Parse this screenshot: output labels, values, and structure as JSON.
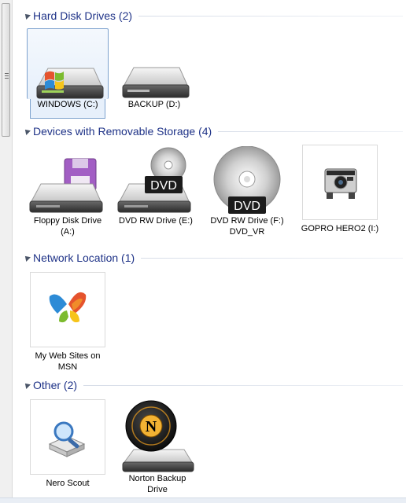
{
  "groups": {
    "hdd": {
      "title": "Hard Disk Drives (2)",
      "items": [
        {
          "label": "WINDOWS (C:)",
          "icon": "windows-drive-icon"
        },
        {
          "label": "BACKUP (D:)",
          "icon": "hard-drive-icon"
        }
      ]
    },
    "removable": {
      "title": "Devices with Removable Storage (4)",
      "items": [
        {
          "label": "Floppy Disk Drive (A:)",
          "icon": "floppy-drive-icon"
        },
        {
          "label": "DVD RW Drive (E:)",
          "icon": "dvd-drive-icon",
          "badge": "DVD"
        },
        {
          "label": "DVD RW Drive (F:) DVD_VR",
          "icon": "dvd-disc-icon",
          "badge": "DVD"
        },
        {
          "label": "GOPRO HERO2 (I:)",
          "icon": "gopro-camera-icon"
        }
      ]
    },
    "network": {
      "title": "Network Location (1)",
      "items": [
        {
          "label": "My Web Sites on MSN",
          "icon": "msn-butterfly-icon"
        }
      ]
    },
    "other": {
      "title": "Other (2)",
      "items": [
        {
          "label": "Nero Scout",
          "icon": "nero-scout-icon"
        },
        {
          "label": "Norton Backup Drive",
          "icon": "norton-backup-icon"
        }
      ]
    }
  },
  "colors": {
    "group_title": "#1e3287",
    "selection_border": "#7da2ce",
    "selection_fill": "#e7f0fb"
  }
}
